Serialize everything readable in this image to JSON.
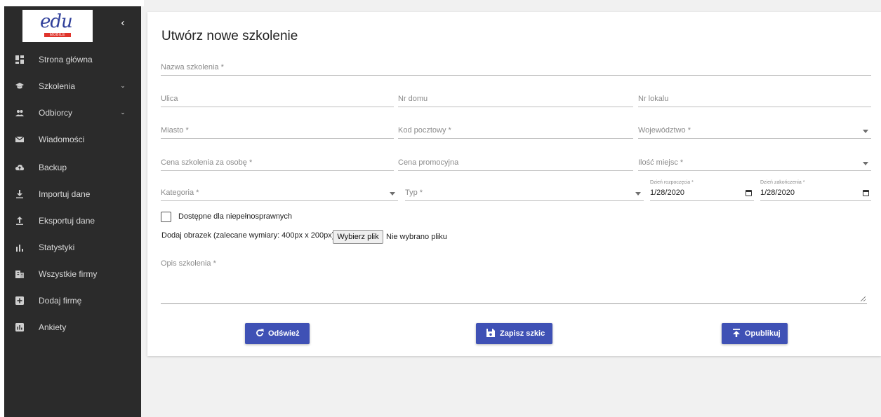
{
  "sidebar": {
    "logo_text": "edu",
    "logo_sub": "MOBILE",
    "items": [
      {
        "label": "Strona główna",
        "icon": "dashboard-icon"
      },
      {
        "label": "Szkolenia",
        "icon": "graduation-cap-icon",
        "has_submenu": true
      },
      {
        "label": "Odbiorcy",
        "icon": "people-icon",
        "has_submenu": true
      },
      {
        "label": "Wiadomości",
        "icon": "envelope-icon"
      },
      {
        "label": "Backup",
        "icon": "cloud-upload-icon"
      },
      {
        "label": "Importuj dane",
        "icon": "download-icon"
      },
      {
        "label": "Eksportuj dane",
        "icon": "upload-icon"
      },
      {
        "label": "Statystyki",
        "icon": "bar-chart-icon"
      },
      {
        "label": "Wszystkie firmy",
        "icon": "building-icon"
      },
      {
        "label": "Dodaj firmę",
        "icon": "plus-box-icon"
      },
      {
        "label": "Ankiety",
        "icon": "poll-icon"
      }
    ]
  },
  "form": {
    "title": "Utwórz nowe szkolenie",
    "name_ph": "Nazwa szkolenia *",
    "street_ph": "Ulica",
    "house_ph": "Nr domu",
    "flat_ph": "Nr lokalu",
    "city_ph": "Miasto *",
    "postal_ph": "Kod pocztowy *",
    "voivodeship_ph": "Województwo *",
    "price_ph": "Cena szkolenia za osobę *",
    "promo_ph": "Cena promocyjna",
    "seats_ph": "Ilość miejsc *",
    "category_ph": "Kategoria *",
    "type_ph": "Typ *",
    "start_label": "Dzień rozpoczęcia *",
    "start_value": "1/28/2020",
    "end_label": "Dzień zakończenia *",
    "end_value": "1/28/2020",
    "accessible_label": "Dostępne dla niepełnosprawnych",
    "accessible_checked": false,
    "image_label": "Dodaj obrazek (zalecane wymiary: 400px x 200px)",
    "file_button": "Wybierz plik",
    "file_status": "Nie wybrano pliku",
    "description_ph": "Opis szkolenia *"
  },
  "actions": {
    "refresh": "Odśwież",
    "save_draft": "Zapisz szkic",
    "publish": "Opublikuj"
  },
  "colors": {
    "sidebar_bg": "#2b2b2b",
    "primary": "#3f51b5",
    "page_bg": "#f1f1f1"
  }
}
